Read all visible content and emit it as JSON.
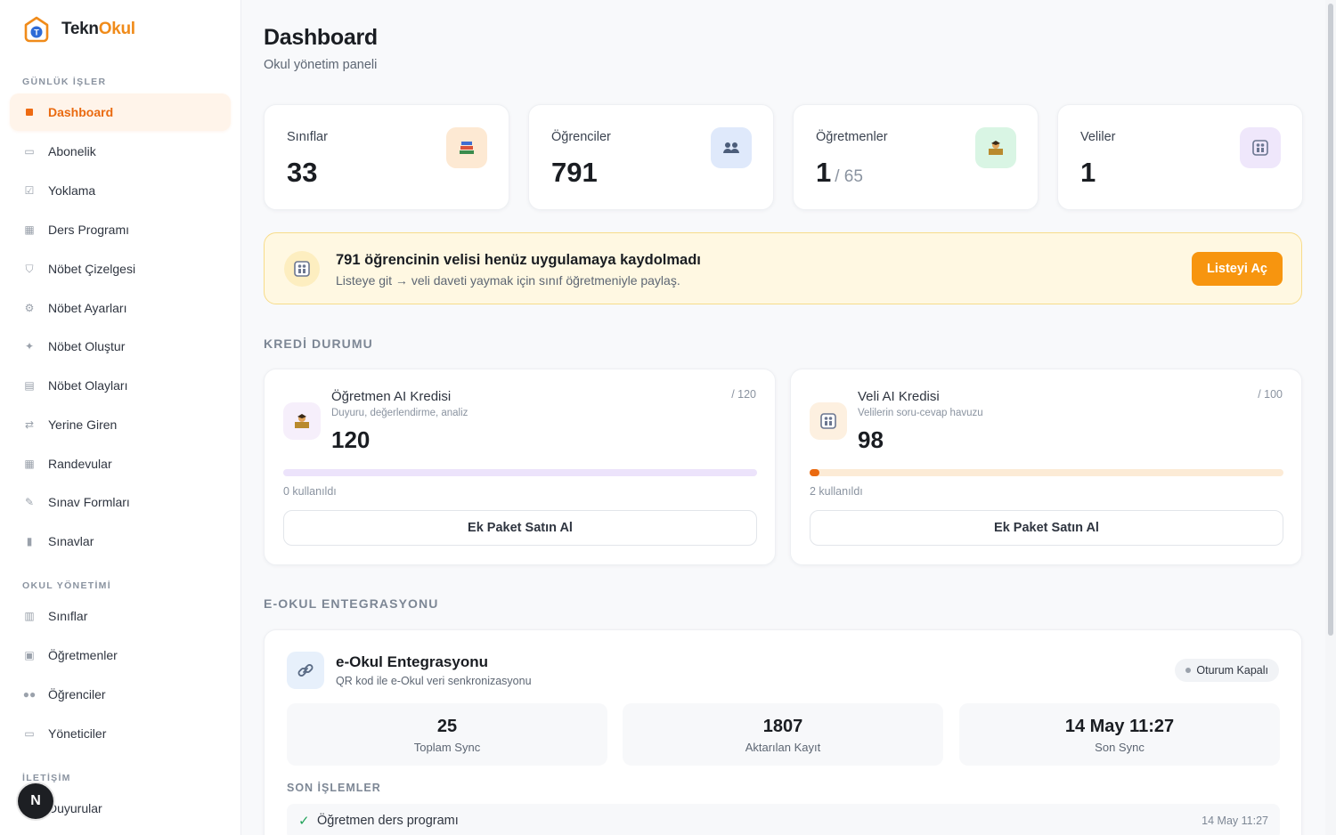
{
  "brand": {
    "name_part1": "Tekn",
    "name_part2": "Okul",
    "accent": "#f08b1a"
  },
  "sidebar": {
    "sections": [
      {
        "title": "GÜNLÜK İŞLER"
      },
      {
        "title": "OKUL YÖNETİMİ"
      },
      {
        "title": "İLETİŞİM"
      }
    ],
    "items": [
      {
        "label": "Dashboard",
        "icon": "square-icon",
        "active": true
      },
      {
        "label": "Abonelik",
        "icon": "credit-card-icon"
      },
      {
        "label": "Yoklama",
        "icon": "checkbox-icon"
      },
      {
        "label": "Ders Programı",
        "icon": "calendar-icon"
      },
      {
        "label": "Nöbet Çizelgesi",
        "icon": "shield-icon"
      },
      {
        "label": "Nöbet Ayarları",
        "icon": "gear-icon"
      },
      {
        "label": "Nöbet Oluştur",
        "icon": "sparkles-icon"
      },
      {
        "label": "Nöbet Olayları",
        "icon": "list-icon"
      },
      {
        "label": "Yerine Giren",
        "icon": "swap-icon"
      },
      {
        "label": "Randevular",
        "icon": "calendar-icon"
      },
      {
        "label": "Sınav Formları",
        "icon": "memo-icon"
      },
      {
        "label": "Sınavlar",
        "icon": "bar-chart-icon"
      },
      {
        "label": "Sınıflar",
        "icon": "books-icon"
      },
      {
        "label": "Öğretmenler",
        "icon": "teacher-icon"
      },
      {
        "label": "Öğrenciler",
        "icon": "people-icon"
      },
      {
        "label": "Yöneticiler",
        "icon": "id-card-icon"
      },
      {
        "label": "Duyurular",
        "icon": "megaphone-icon"
      }
    ],
    "badge": "N"
  },
  "header": {
    "title": "Dashboard",
    "subtitle": "Okul yönetim paneli"
  },
  "stats": [
    {
      "label": "Sınıflar",
      "value": "33",
      "icon": "books-icon"
    },
    {
      "label": "Öğrenciler",
      "value": "791",
      "icon": "people-icon"
    },
    {
      "label": "Öğretmenler",
      "value": "1",
      "value_suffix": "/ 65",
      "icon": "teacher-icon"
    },
    {
      "label": "Veliler",
      "value": "1",
      "icon": "family-icon"
    }
  ],
  "banner": {
    "title": "791 öğrencinin velisi henüz uygulamaya kaydolmadı",
    "subtitle": "Listeye git → veli daveti yaymak için sınıf öğretmeniyle paylaş.",
    "button": "Listeyi Aç",
    "icon": "family-icon"
  },
  "credit": {
    "section_title": "KREDİ DURUMU",
    "cards": [
      {
        "title": "Öğretmen AI Kredisi",
        "desc": "Duyuru, değerlendirme, analiz",
        "max": "/ 120",
        "value": "120",
        "used": "0 kullanıldı",
        "used_fraction": 0.0,
        "button": "Ek Paket Satın Al",
        "icon": "teacher-icon",
        "track_color": "#ece3fb",
        "fill_color": "#a879ee"
      },
      {
        "title": "Veli AI Kredisi",
        "desc": "Velilerin soru-cevap havuzu",
        "max": "/ 100",
        "value": "98",
        "used": "2 kullanıldı",
        "used_fraction": 0.02,
        "button": "Ek Paket Satın Al",
        "icon": "family-icon",
        "track_color": "#fcebd6",
        "fill_color": "#ea6a10"
      }
    ]
  },
  "eokul": {
    "section_title": "E-OKUL ENTEGRASYONU",
    "title": "e-Okul Entegrasyonu",
    "subtitle": "QR kod ile e-Okul veri senkronizasyonu",
    "status": "Oturum Kapalı",
    "icon": "link-icon",
    "metrics": [
      {
        "value": "25",
        "label": "Toplam Sync"
      },
      {
        "value": "1807",
        "label": "Aktarılan Kayıt"
      },
      {
        "value": "14 May 11:27",
        "label": "Son Sync"
      }
    ],
    "recent_title": "SON İŞLEMLER",
    "recent": [
      {
        "name": "Öğretmen ders programı",
        "time": "14 May 11:27"
      }
    ]
  }
}
